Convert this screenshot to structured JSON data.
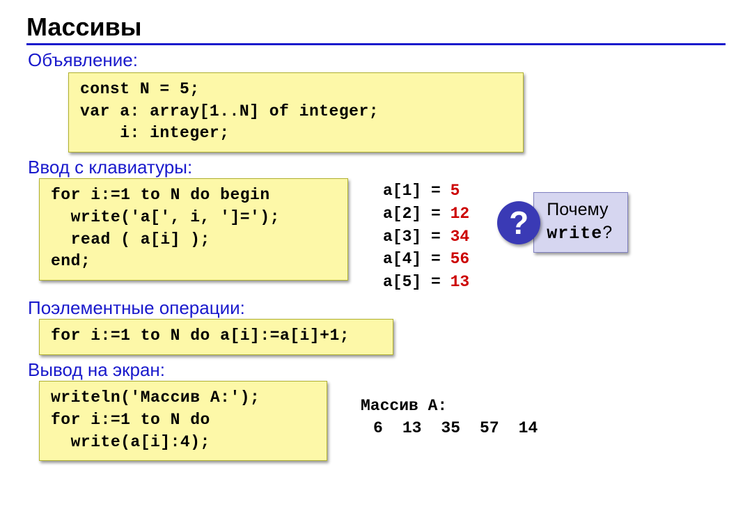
{
  "title": "Массивы",
  "sections": {
    "declare": "Объявление:",
    "input": "Ввод с клавиатуры:",
    "elementwise": "Поэлементные операции:",
    "output": "Вывод на экран:"
  },
  "code": {
    "declare": "const N = 5;\nvar a: array[1..N] of integer;\n    i: integer;",
    "input": "for i:=1 to N do begin\n  write('a[', i, ']=');\n  read ( a[i] );\nend;",
    "elementwise": "for i:=1 to N do a[i]:=a[i]+1;",
    "output": "writeln('Массив A:');\nfor i:=1 to N do \n  write(a[i]:4);"
  },
  "input_values": [
    {
      "label": "a[1] = ",
      "value": "5"
    },
    {
      "label": "a[2] = ",
      "value": "12"
    },
    {
      "label": "a[3] = ",
      "value": "34"
    },
    {
      "label": "a[4] = ",
      "value": "56"
    },
    {
      "label": "a[5] = ",
      "value": "13"
    }
  ],
  "callout": {
    "q": "?",
    "line1": "Почему",
    "line2_mono": "write",
    "line2_tail": "?"
  },
  "final_output": {
    "header": "Массив A:",
    "values": [
      "6",
      "13",
      "35",
      "57",
      "14"
    ]
  }
}
